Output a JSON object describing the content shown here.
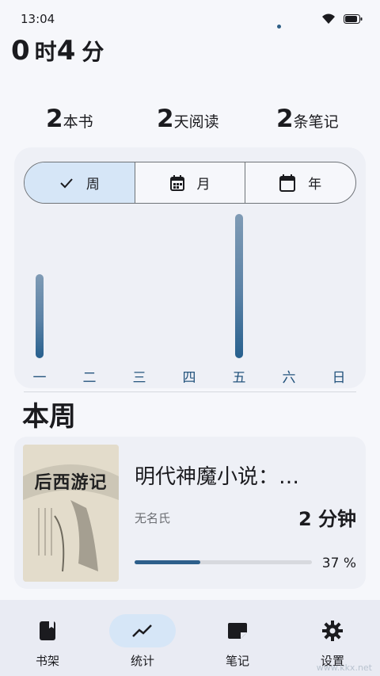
{
  "status_bar": {
    "time": "13:04"
  },
  "total_time": {
    "hours": "0",
    "hours_unit": "时",
    "minutes": "4",
    "minutes_unit": "分"
  },
  "summary": [
    {
      "num": "2",
      "label": "本书"
    },
    {
      "num": "2",
      "label": "天阅读"
    },
    {
      "num": "2",
      "label": "条笔记"
    }
  ],
  "period_tabs": [
    {
      "label": "周",
      "icon": "check-icon",
      "active": true
    },
    {
      "label": "月",
      "icon": "calendar-month-icon",
      "active": false
    },
    {
      "label": "年",
      "icon": "calendar-year-icon",
      "active": false
    }
  ],
  "chart_data": {
    "type": "bar",
    "categories": [
      "一",
      "二",
      "三",
      "四",
      "五",
      "六",
      "日"
    ],
    "values": [
      1.17,
      0,
      0,
      0,
      2.0,
      0,
      0
    ],
    "ylim": [
      0,
      2.0
    ],
    "grid": false
  },
  "section_title": "本周",
  "book": {
    "title": "明代神魔小说：…",
    "author": "无名氏",
    "time": "2 分钟",
    "progress": 0.37,
    "progress_text": "37 %",
    "cover_title": "后西游记"
  },
  "bottom_nav": [
    {
      "label": "书架",
      "icon": "bookshelf-icon",
      "active": false
    },
    {
      "label": "统计",
      "icon": "stats-icon",
      "active": true
    },
    {
      "label": "笔记",
      "icon": "note-icon",
      "active": false
    },
    {
      "label": "设置",
      "icon": "gear-icon",
      "active": false
    }
  ],
  "colors": {
    "accent": "#2d5f8b",
    "active_bg": "#d6e6f7"
  },
  "watermark": "www.kkx.net"
}
